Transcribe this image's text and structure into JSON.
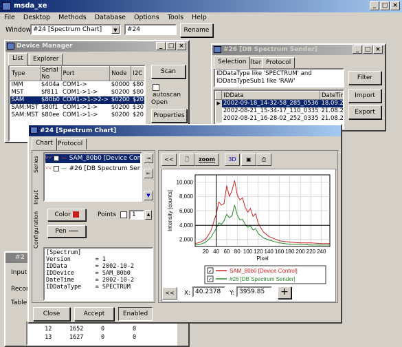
{
  "app": {
    "title": "msda_xe",
    "menu": [
      "File",
      "Desktop",
      "Methods",
      "Database",
      "Options",
      "Tools",
      "Help"
    ],
    "window_label": "Window",
    "window_select": "#24 [Spectrum Chart]",
    "window_field": "#24",
    "rename_label": "Rename"
  },
  "device_manager": {
    "title": "Device Manager",
    "tabs": [
      "List",
      "Explorer"
    ],
    "columns": [
      "Type",
      "Serial No",
      "Port",
      "Node",
      "I2C"
    ],
    "rows": [
      [
        "IMM",
        "$404a",
        "COM1->",
        "$0000",
        "$80"
      ],
      [
        "MST",
        "$f811",
        "COM1->1->",
        "$0200",
        "$80"
      ],
      [
        "SAM",
        "$80b0",
        "COM1->1->2->",
        "$0200",
        "$20"
      ],
      [
        "SAM:MST",
        "$80f1",
        "COM1->1->",
        "$0200",
        "$30"
      ],
      [
        "SAM:MST",
        "$80ee",
        "COM1->1->",
        "$0200",
        "$20"
      ]
    ],
    "scan_label": "Scan",
    "autoscan_label": "autoscan",
    "open_label": "Open",
    "properties_label": "Properties"
  },
  "sender": {
    "title": "#26 [DB Spectrum Sender]",
    "tabs": [
      "Selection",
      "Filter",
      "Protocol"
    ],
    "query": "IDDataType like 'SPECTRUM' and IDDataTypeSub1 like 'RAW'",
    "columns": [
      "IDData",
      "DateTim"
    ],
    "rows": [
      [
        "2002-09-18_14-32-58_285_0536",
        "18.09.20"
      ],
      [
        "2002-08-21_15-34-17_110_0335",
        "21.08.20"
      ],
      [
        "2002-08-21_16-28-02_252_0335",
        "21.08.20"
      ]
    ],
    "filter_label": "Filter",
    "import_label": "Import",
    "export_label": "Export"
  },
  "chart_window": {
    "title": "#24 [Spectrum Chart]",
    "tabs": [
      "Chart",
      "Protocol"
    ],
    "side_tabs": [
      "Series",
      "Input",
      "Configuration"
    ],
    "series_list": [
      "SAM_80b0 [Device Control]",
      "#26 [DB Spectrum Sender]"
    ],
    "color_label": "Color",
    "pen_label": "Pen",
    "points_label": "Points",
    "points_value": "1",
    "info_lines": [
      "[Spectrum]",
      "Version       = 1",
      "IDData        = 2002-10-2",
      "IDDevice      = SAM_80b0",
      "DateTime      = 2002-10-2",
      "IDDataType    = SPECTRUM"
    ],
    "nav_prev": "<<",
    "zoom_label": "zoom",
    "threed_label": "3D",
    "x_label": "X:",
    "x_value": "40.2378",
    "y_label": "Y:",
    "y_value": "3959.85",
    "close_label": "Close",
    "accept_label": "Accept",
    "enabled_label": "Enabled",
    "red": "#cc2020",
    "green": "#2a8a2a"
  },
  "bg_window": {
    "title": "#2",
    "input_label": "Input",
    "record_label": "Recor",
    "table_label": "Table",
    "rows": [
      [
        "12",
        "1652",
        "0",
        "0"
      ],
      [
        "13",
        "1627",
        "0",
        "0"
      ]
    ]
  },
  "chart_data": {
    "type": "line",
    "xlabel": "Pixel",
    "ylabel": "Intensity [counts]",
    "xlim": [
      0,
      256
    ],
    "ylim": [
      1000,
      11000
    ],
    "xticks": [
      20,
      40,
      60,
      80,
      100,
      120,
      140,
      160,
      180,
      200,
      220,
      240
    ],
    "yticks": [
      2000,
      4000,
      6000,
      8000,
      10000
    ],
    "ytick_labels": [
      "2,000",
      "4,000",
      "6,000",
      "8,000",
      "10,000"
    ],
    "series": [
      {
        "name": "SAM_80b0 [Device Control]",
        "x": [
          0,
          10,
          20,
          30,
          40,
          45,
          50,
          55,
          60,
          65,
          70,
          75,
          80,
          85,
          90,
          95,
          100,
          105,
          110,
          115,
          120,
          125,
          130,
          140,
          150,
          160,
          170,
          180,
          200,
          220,
          240,
          256
        ],
        "y": [
          1400,
          1600,
          2000,
          3200,
          5500,
          7200,
          6800,
          7000,
          9500,
          8000,
          8800,
          10200,
          8200,
          7500,
          7800,
          6500,
          5800,
          6300,
          5200,
          5600,
          4200,
          3600,
          3000,
          2400,
          2100,
          1800,
          1700,
          1600,
          1500,
          1500,
          1400,
          1400
        ]
      },
      {
        "name": "#26 [DB Spectrum Sender]",
        "x": [
          0,
          10,
          20,
          30,
          40,
          45,
          50,
          55,
          60,
          65,
          70,
          75,
          80,
          85,
          90,
          95,
          100,
          105,
          110,
          115,
          120,
          125,
          130,
          140,
          150,
          160,
          170,
          180,
          200,
          220,
          240,
          256
        ],
        "y": [
          1200,
          1300,
          1600,
          2300,
          3500,
          4300,
          4100,
          4600,
          5500,
          5000,
          5300,
          6800,
          5400,
          4700,
          4800,
          4100,
          3700,
          3900,
          3300,
          3500,
          2800,
          2500,
          2200,
          1900,
          1700,
          1500,
          1400,
          1300,
          1300,
          1200,
          1200,
          1200
        ]
      }
    ],
    "crosshair_x": 40.2378,
    "crosshair_y": 3959.85
  }
}
